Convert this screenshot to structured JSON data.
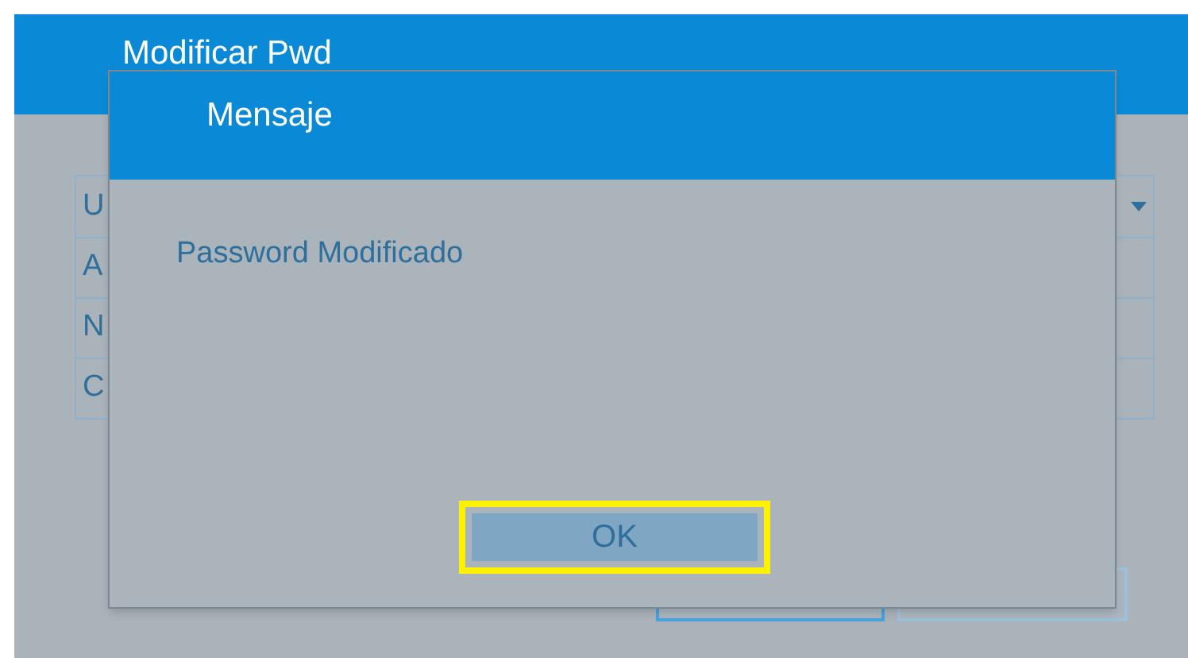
{
  "window": {
    "title": "Modificar Pwd"
  },
  "form": {
    "rows": [
      {
        "label": "U",
        "kind": "dropdown"
      },
      {
        "label": "A",
        "kind": "text"
      },
      {
        "label": "N",
        "kind": "text"
      },
      {
        "label": "C",
        "kind": "text"
      }
    ]
  },
  "dialog": {
    "title": "Mensaje",
    "message": "Password Modificado",
    "button": {
      "label": "OK",
      "highlighted": true
    }
  }
}
